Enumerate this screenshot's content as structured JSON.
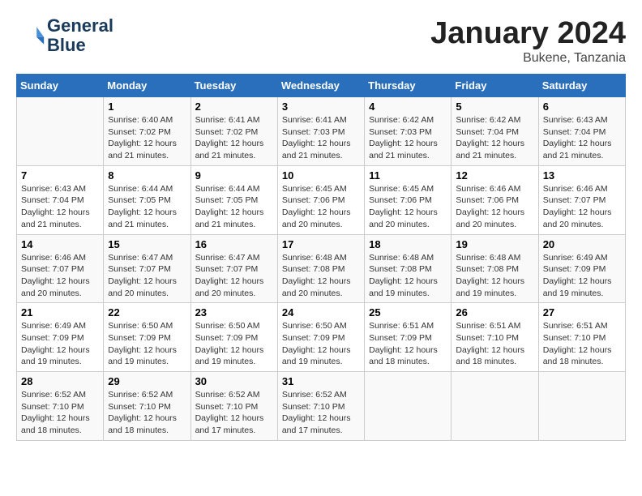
{
  "header": {
    "logo_line1": "General",
    "logo_line2": "Blue",
    "month": "January 2024",
    "location": "Bukene, Tanzania"
  },
  "weekdays": [
    "Sunday",
    "Monday",
    "Tuesday",
    "Wednesday",
    "Thursday",
    "Friday",
    "Saturday"
  ],
  "weeks": [
    [
      {
        "day": "",
        "sunrise": "",
        "sunset": "",
        "daylight": ""
      },
      {
        "day": "1",
        "sunrise": "Sunrise: 6:40 AM",
        "sunset": "Sunset: 7:02 PM",
        "daylight": "Daylight: 12 hours and 21 minutes."
      },
      {
        "day": "2",
        "sunrise": "Sunrise: 6:41 AM",
        "sunset": "Sunset: 7:02 PM",
        "daylight": "Daylight: 12 hours and 21 minutes."
      },
      {
        "day": "3",
        "sunrise": "Sunrise: 6:41 AM",
        "sunset": "Sunset: 7:03 PM",
        "daylight": "Daylight: 12 hours and 21 minutes."
      },
      {
        "day": "4",
        "sunrise": "Sunrise: 6:42 AM",
        "sunset": "Sunset: 7:03 PM",
        "daylight": "Daylight: 12 hours and 21 minutes."
      },
      {
        "day": "5",
        "sunrise": "Sunrise: 6:42 AM",
        "sunset": "Sunset: 7:04 PM",
        "daylight": "Daylight: 12 hours and 21 minutes."
      },
      {
        "day": "6",
        "sunrise": "Sunrise: 6:43 AM",
        "sunset": "Sunset: 7:04 PM",
        "daylight": "Daylight: 12 hours and 21 minutes."
      }
    ],
    [
      {
        "day": "7",
        "sunrise": "Sunrise: 6:43 AM",
        "sunset": "Sunset: 7:04 PM",
        "daylight": "Daylight: 12 hours and 21 minutes."
      },
      {
        "day": "8",
        "sunrise": "Sunrise: 6:44 AM",
        "sunset": "Sunset: 7:05 PM",
        "daylight": "Daylight: 12 hours and 21 minutes."
      },
      {
        "day": "9",
        "sunrise": "Sunrise: 6:44 AM",
        "sunset": "Sunset: 7:05 PM",
        "daylight": "Daylight: 12 hours and 21 minutes."
      },
      {
        "day": "10",
        "sunrise": "Sunrise: 6:45 AM",
        "sunset": "Sunset: 7:06 PM",
        "daylight": "Daylight: 12 hours and 20 minutes."
      },
      {
        "day": "11",
        "sunrise": "Sunrise: 6:45 AM",
        "sunset": "Sunset: 7:06 PM",
        "daylight": "Daylight: 12 hours and 20 minutes."
      },
      {
        "day": "12",
        "sunrise": "Sunrise: 6:46 AM",
        "sunset": "Sunset: 7:06 PM",
        "daylight": "Daylight: 12 hours and 20 minutes."
      },
      {
        "day": "13",
        "sunrise": "Sunrise: 6:46 AM",
        "sunset": "Sunset: 7:07 PM",
        "daylight": "Daylight: 12 hours and 20 minutes."
      }
    ],
    [
      {
        "day": "14",
        "sunrise": "Sunrise: 6:46 AM",
        "sunset": "Sunset: 7:07 PM",
        "daylight": "Daylight: 12 hours and 20 minutes."
      },
      {
        "day": "15",
        "sunrise": "Sunrise: 6:47 AM",
        "sunset": "Sunset: 7:07 PM",
        "daylight": "Daylight: 12 hours and 20 minutes."
      },
      {
        "day": "16",
        "sunrise": "Sunrise: 6:47 AM",
        "sunset": "Sunset: 7:07 PM",
        "daylight": "Daylight: 12 hours and 20 minutes."
      },
      {
        "day": "17",
        "sunrise": "Sunrise: 6:48 AM",
        "sunset": "Sunset: 7:08 PM",
        "daylight": "Daylight: 12 hours and 20 minutes."
      },
      {
        "day": "18",
        "sunrise": "Sunrise: 6:48 AM",
        "sunset": "Sunset: 7:08 PM",
        "daylight": "Daylight: 12 hours and 19 minutes."
      },
      {
        "day": "19",
        "sunrise": "Sunrise: 6:48 AM",
        "sunset": "Sunset: 7:08 PM",
        "daylight": "Daylight: 12 hours and 19 minutes."
      },
      {
        "day": "20",
        "sunrise": "Sunrise: 6:49 AM",
        "sunset": "Sunset: 7:09 PM",
        "daylight": "Daylight: 12 hours and 19 minutes."
      }
    ],
    [
      {
        "day": "21",
        "sunrise": "Sunrise: 6:49 AM",
        "sunset": "Sunset: 7:09 PM",
        "daylight": "Daylight: 12 hours and 19 minutes."
      },
      {
        "day": "22",
        "sunrise": "Sunrise: 6:50 AM",
        "sunset": "Sunset: 7:09 PM",
        "daylight": "Daylight: 12 hours and 19 minutes."
      },
      {
        "day": "23",
        "sunrise": "Sunrise: 6:50 AM",
        "sunset": "Sunset: 7:09 PM",
        "daylight": "Daylight: 12 hours and 19 minutes."
      },
      {
        "day": "24",
        "sunrise": "Sunrise: 6:50 AM",
        "sunset": "Sunset: 7:09 PM",
        "daylight": "Daylight: 12 hours and 19 minutes."
      },
      {
        "day": "25",
        "sunrise": "Sunrise: 6:51 AM",
        "sunset": "Sunset: 7:09 PM",
        "daylight": "Daylight: 12 hours and 18 minutes."
      },
      {
        "day": "26",
        "sunrise": "Sunrise: 6:51 AM",
        "sunset": "Sunset: 7:10 PM",
        "daylight": "Daylight: 12 hours and 18 minutes."
      },
      {
        "day": "27",
        "sunrise": "Sunrise: 6:51 AM",
        "sunset": "Sunset: 7:10 PM",
        "daylight": "Daylight: 12 hours and 18 minutes."
      }
    ],
    [
      {
        "day": "28",
        "sunrise": "Sunrise: 6:52 AM",
        "sunset": "Sunset: 7:10 PM",
        "daylight": "Daylight: 12 hours and 18 minutes."
      },
      {
        "day": "29",
        "sunrise": "Sunrise: 6:52 AM",
        "sunset": "Sunset: 7:10 PM",
        "daylight": "Daylight: 12 hours and 18 minutes."
      },
      {
        "day": "30",
        "sunrise": "Sunrise: 6:52 AM",
        "sunset": "Sunset: 7:10 PM",
        "daylight": "Daylight: 12 hours and 17 minutes."
      },
      {
        "day": "31",
        "sunrise": "Sunrise: 6:52 AM",
        "sunset": "Sunset: 7:10 PM",
        "daylight": "Daylight: 12 hours and 17 minutes."
      },
      {
        "day": "",
        "sunrise": "",
        "sunset": "",
        "daylight": ""
      },
      {
        "day": "",
        "sunrise": "",
        "sunset": "",
        "daylight": ""
      },
      {
        "day": "",
        "sunrise": "",
        "sunset": "",
        "daylight": ""
      }
    ]
  ]
}
